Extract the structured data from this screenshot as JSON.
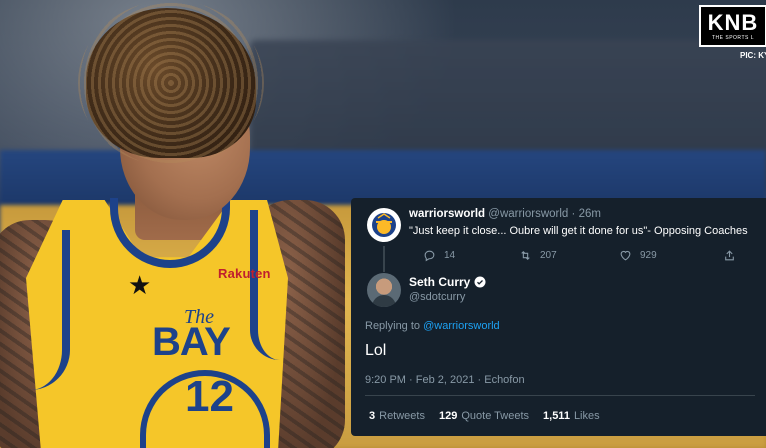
{
  "watermark": {
    "logo_text": "KNB",
    "logo_subtext": "THE SPORTS L",
    "credit": "PIC: KYL"
  },
  "jersey": {
    "brand": "Rakuten",
    "the": "The",
    "team_text": "BAY",
    "number": "12"
  },
  "original_tweet": {
    "display_name": "warriorsworld",
    "handle": "@warriorsworld",
    "separator": "·",
    "time_ago": "26m",
    "text": "\"Just keep it close... Oubre will get it done for us\"- Opposing Coaches",
    "reply_count": "14",
    "retweet_count": "207",
    "like_count": "929"
  },
  "reply_tweet": {
    "display_name": "Seth Curry",
    "handle": "@sdotcurry",
    "replying_to_label": "Replying to",
    "replying_to_handle": "@warriorsworld",
    "text": "Lol",
    "meta": "9:20 PM · Feb 2, 2021 · Echofon",
    "stats": {
      "retweets_count": "3",
      "retweets_label": "Retweets",
      "quote_tweets_count": "129",
      "quote_tweets_label": "Quote Tweets",
      "likes_count": "1,511",
      "likes_label": "Likes"
    }
  },
  "colors": {
    "card_background": "#15202b",
    "link_blue": "#1da1f2",
    "muted_text": "#8899a6",
    "jersey_yellow": "#f5c629",
    "jersey_blue": "#1d428a"
  },
  "icons": [
    "reply-icon",
    "retweet-icon",
    "like-icon",
    "share-icon",
    "verified-icon",
    "jumpman-logo"
  ]
}
